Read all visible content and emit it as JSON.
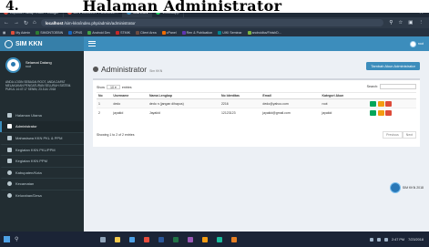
{
  "document": {
    "bullet": "4.",
    "heading": "Halaman Administrator"
  },
  "browser": {
    "tabs": [
      {
        "label": "Laporan Tahap Rutin - Google",
        "color": "#d94b3f"
      },
      {
        "label": "DEV KEMROT - CORELL...",
        "color": "#d94b3f"
      },
      {
        "label": "SIM KKN",
        "color": "#3c8dbc",
        "active": true
      },
      {
        "label": "WhatsApp",
        "color": "#25d366"
      }
    ],
    "url_host": "localhost",
    "url_path": "/sim-kkn/index.php/admin/administrator",
    "bookmarks": [
      {
        "label": "My Admin",
        "color": "#e04e39"
      },
      {
        "label": "SIMONTOEBIN",
        "color": "#2e7d32"
      },
      {
        "label": "CPNS",
        "color": "#1565c0"
      },
      {
        "label": "Android Dev",
        "color": "#43a047"
      },
      {
        "label": "STMIK",
        "color": "#c62828"
      },
      {
        "label": "Client Area",
        "color": "#6d4c41"
      },
      {
        "label": "cPanel",
        "color": "#ef6c00"
      },
      {
        "label": "Ren & Publication",
        "color": "#5e35b1"
      },
      {
        "label": "UIKI Seminar",
        "color": "#00838f"
      },
      {
        "label": "androidba/FinishD...",
        "color": "#7cb342"
      }
    ]
  },
  "app": {
    "name": "SIM KKN",
    "user": {
      "name": "Selamat Datang",
      "status": "root"
    },
    "notice": "ANDA LOGIN SEBAGAI ROOT, ANDA DAPAT MELAKUKAN PENGATURAN SELURUH SISTEM. PUKUL 14:47:17 SENIN, 23 JULI 2018",
    "menu": [
      {
        "label": "Halaman Utama",
        "icon": "home-icon"
      },
      {
        "label": "Administrator",
        "icon": "user-shield-icon",
        "active": true
      },
      {
        "label": "Mahasiswa KKN PKL & PPM",
        "icon": "student-icon"
      },
      {
        "label": "Kegiatan KKN PKL/PPM",
        "icon": "activity-icon"
      },
      {
        "label": "Kegiatan KKN PPM",
        "icon": "activity-icon"
      },
      {
        "label": "Kabupaten/Kota",
        "icon": "map-pin-icon"
      },
      {
        "label": "Kecamatan",
        "icon": "map-pin-icon"
      },
      {
        "label": "Kelurahan/Desa",
        "icon": "map-pin-icon"
      }
    ],
    "topnav_user": "root"
  },
  "page": {
    "title": "Administrator",
    "subtitle": "Sim KKN",
    "add_button": "Tambah Akun Administrator",
    "show_label": "Show",
    "entries_value": "10",
    "entries_label": "entries",
    "search_label": "Search:",
    "columns": [
      "No",
      "Username",
      "Nama Lengkap",
      "No Identitas",
      "Email",
      "Kategori Akun",
      ""
    ],
    "rows": [
      {
        "no": "1",
        "username": "dedo",
        "fullname": "dedo n (jangan dihapus)",
        "identity": "2216",
        "email": "dedo@yahoo.com",
        "category": "root"
      },
      {
        "no": "2",
        "username": "jayakid",
        "fullname": "Jayakid",
        "identity": "12123123",
        "email": "jayakid@gmail.com",
        "category": "jayakid"
      }
    ],
    "info": "Showing 1 to 2 of 2 entries",
    "pager_prev": "Previous",
    "pager_next": "Next",
    "footer_badge": "SIM KKN 2018"
  },
  "taskbar": {
    "time": "2:47 PM",
    "date": "7/23/2018"
  },
  "colors": {
    "sidebar": "#222d32",
    "accent": "#3c8dbc",
    "view": "#00a65a",
    "edit": "#f39c12",
    "delete": "#dd4b39"
  }
}
